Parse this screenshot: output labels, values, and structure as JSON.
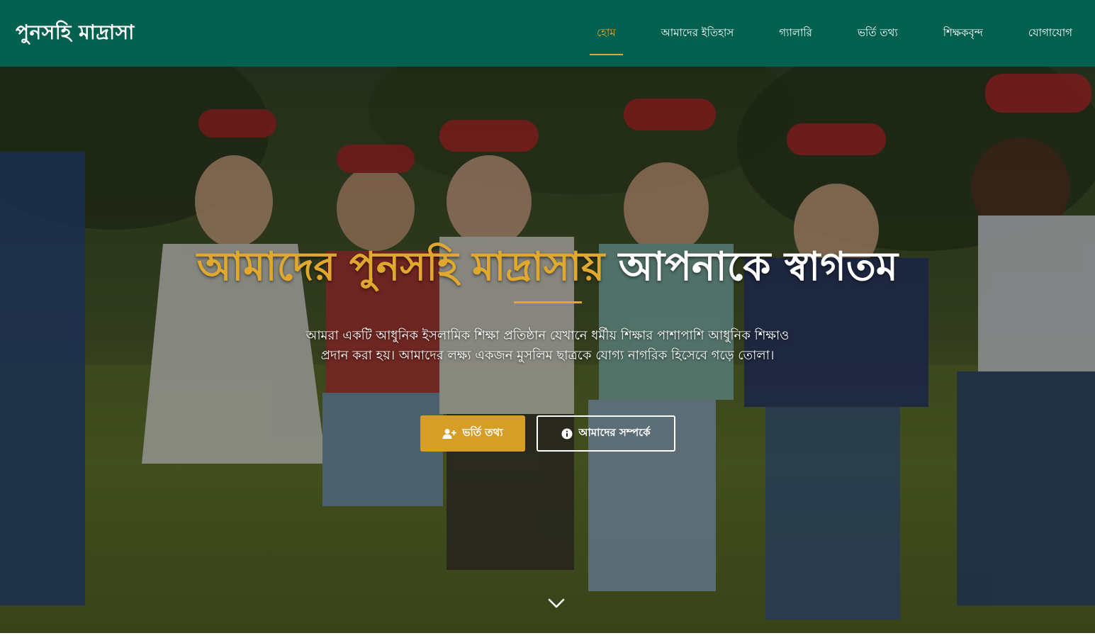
{
  "nav": {
    "brand": "পুনসহি মাদ্রাসা",
    "items": [
      {
        "label": "হোম",
        "active": true
      },
      {
        "label": "আমাদের ইতিহাস",
        "active": false
      },
      {
        "label": "গ্যালারি",
        "active": false
      },
      {
        "label": "ভর্তি তথ্য",
        "active": false
      },
      {
        "label": "শিক্ষকবৃন্দ",
        "active": false
      },
      {
        "label": "যোগাযোগ",
        "active": false
      }
    ]
  },
  "hero": {
    "title_highlight": "আমাদের পুনসহি মাদ্রাসায়",
    "title_rest": "আপনাকে স্বাগতম",
    "description": "আমরা একটি আধুনিক ইসলামিক শিক্ষা প্রতিষ্ঠান যেখানে ধর্মীয় শিক্ষার পাশাপাশি আধুনিক শিক্ষাও প্রদান করা হয়। আমাদের লক্ষ্য একজন মুসলিম ছাত্রকে যোগ্য নাগরিক হিসেবে গড়ে তোলা।",
    "primary_button": "ভর্তি তথ্য",
    "secondary_button": "আমাদের সম্পর্কে",
    "primary_icon": "user-plus-icon",
    "secondary_icon": "info-circle-icon",
    "scroll_icon": "chevron-down-icon"
  },
  "colors": {
    "nav_bg": "#04604f",
    "accent": "#e0a82e",
    "primary_button": "#d69e25"
  }
}
